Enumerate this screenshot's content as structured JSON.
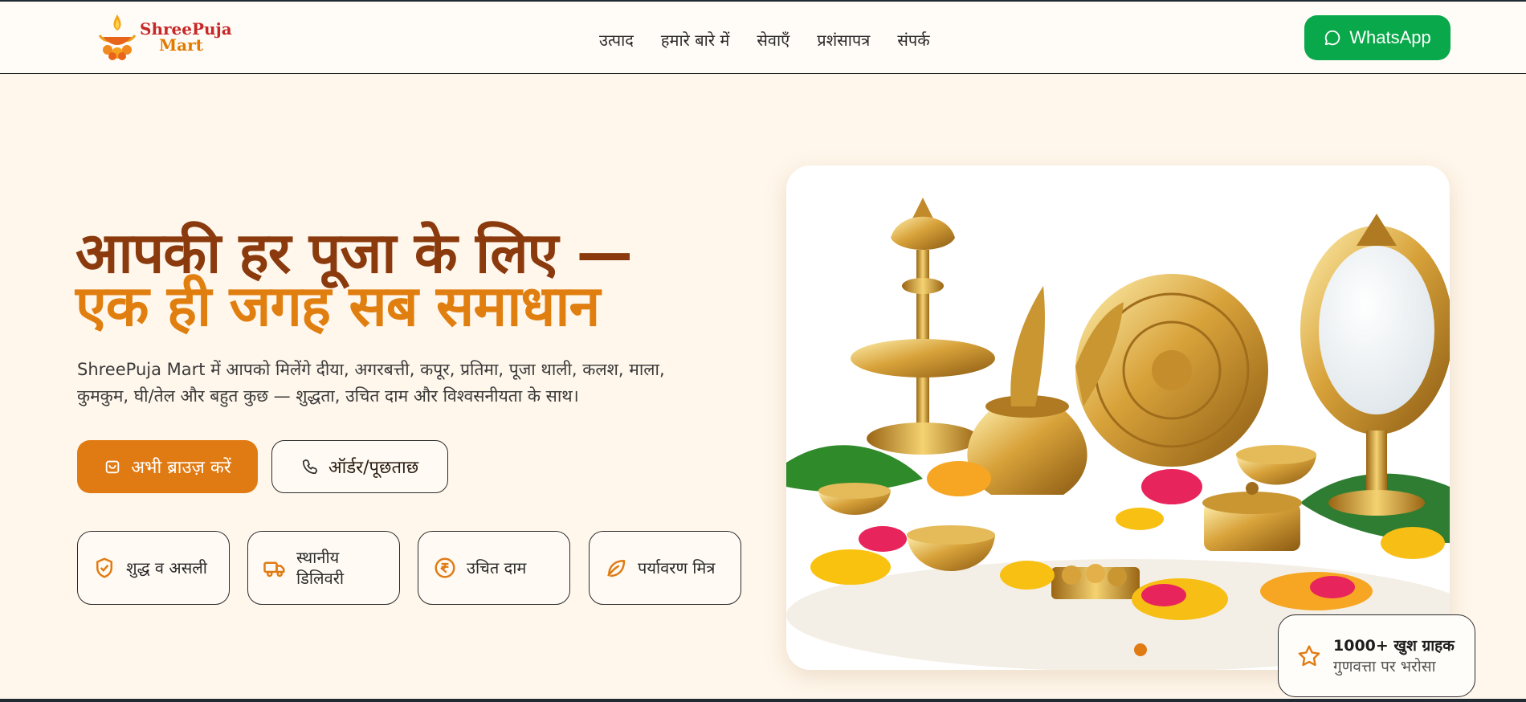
{
  "brand": {
    "line1": "ShreePuja",
    "line2": "Mart",
    "logo_icon": "diya-lamp-icon"
  },
  "nav": {
    "items": [
      "उत्पाद",
      "हमारे बारे में",
      "सेवाएँ",
      "प्रशंसापत्र",
      "संपर्क"
    ]
  },
  "header": {
    "whatsapp_label": "WhatsApp",
    "whatsapp_icon": "chat-bubble-icon",
    "whatsapp_color": "#09a84a"
  },
  "hero": {
    "title_line1": "आपकी हर पूजा के लिए —",
    "title_line2": "एक ही जगह सब समाधान",
    "description": "ShreePuja Mart में आपको मिलेंगे दीया, अगरबत्ती, कपूर, प्रतिमा, पूजा थाली, कलश, माला, कुमकुम, घी/तेल और बहुत कुछ — शुद्धता, उचित दाम और विश्वसनीयता के साथ।",
    "primary_button": "अभी ब्राउज़ करें",
    "primary_icon": "shopping-bag-icon",
    "secondary_button": "ऑर्डर/पूछताछ",
    "secondary_icon": "phone-icon",
    "accent_color": "#e07b14",
    "title_color": "#8a3a0c"
  },
  "features": [
    {
      "label": "शुद्ध व असली",
      "icon": "shield-check-icon"
    },
    {
      "label": "स्थानीय डिलिवरी",
      "icon": "truck-icon"
    },
    {
      "label": "उचित दाम",
      "icon": "rupee-icon"
    },
    {
      "label": "पर्यावरण मित्र",
      "icon": "leaf-icon"
    }
  ],
  "carousel": {
    "image_alt": "brass puja items",
    "active_slide": 1
  },
  "badge": {
    "line1": "1000+ खुश ग्राहक",
    "line2": "गुणवत्ता पर भरोसा",
    "icon": "star-icon"
  }
}
